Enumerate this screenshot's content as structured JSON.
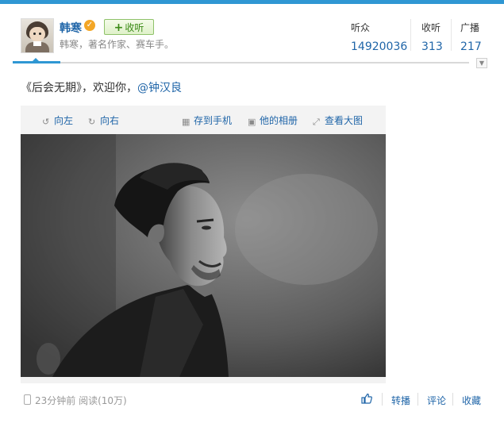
{
  "profile": {
    "name": "韩寒",
    "verified_badge": "✓",
    "follow_label": "收听",
    "follow_plus": "+",
    "bio": "韩寒，著名作家、赛车手。"
  },
  "stats": [
    {
      "label": "听众",
      "value": "14920036"
    },
    {
      "label": "收听",
      "value": "313"
    },
    {
      "label": "广播",
      "value": "217"
    }
  ],
  "post": {
    "text": "《后会无期》，欢迎你，",
    "mention": "@钟汉良"
  },
  "image_toolbar": {
    "rotate_left": "向左",
    "rotate_right": "向右",
    "save_to_phone": "存到手机",
    "album": "他的相册",
    "view_large": "查看大图"
  },
  "footer": {
    "time": "23分钟前",
    "reads": "阅读(10万)",
    "repost": "转播",
    "comment": "评论",
    "favorite": "收藏"
  },
  "colors": {
    "link": "#1f65a8",
    "accent": "#2f97d3",
    "follow_green": "#3a8a16"
  },
  "icons": [
    "rotate-left-icon",
    "rotate-right-icon",
    "save-phone-icon",
    "album-icon",
    "view-large-icon",
    "phone-icon",
    "thumbs-up-icon",
    "chevron-down-icon",
    "verified-icon"
  ]
}
